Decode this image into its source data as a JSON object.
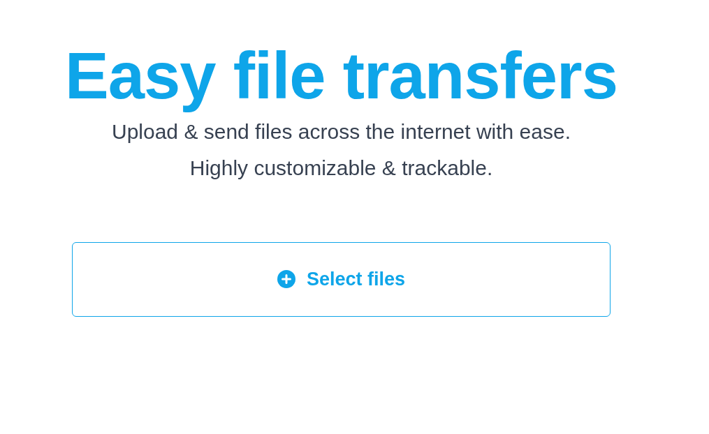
{
  "hero": {
    "title": "Easy file transfers",
    "subtitle_lines": [
      "Upload & send files across the internet with ease.",
      "Highly customizable & trackable."
    ]
  },
  "upload": {
    "label": "Select files"
  }
}
